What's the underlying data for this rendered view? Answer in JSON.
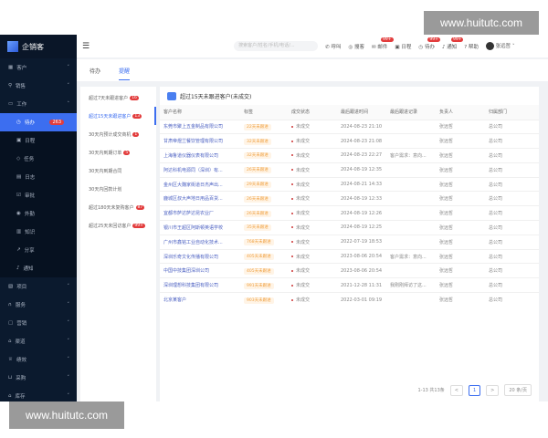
{
  "watermark": "www.huitutc.com",
  "app": {
    "name": "企销客"
  },
  "sidebar": {
    "items": [
      {
        "label": "客户",
        "icon": "customer-icon",
        "chevron": "˅"
      },
      {
        "label": "销售",
        "icon": "person-icon",
        "chevron": "˅"
      },
      {
        "label": "工作",
        "icon": "briefcase-icon",
        "chevron": "˄"
      },
      {
        "label": "待办",
        "icon": "clock-icon",
        "badge": "263",
        "sub": true,
        "active": true
      },
      {
        "label": "日程",
        "icon": "calendar-icon",
        "sub": true
      },
      {
        "label": "任务",
        "icon": "tag-icon",
        "sub": true
      },
      {
        "label": "日志",
        "icon": "log-icon",
        "sub": true
      },
      {
        "label": "审批",
        "icon": "approve-icon",
        "sub": true
      },
      {
        "label": "外勤",
        "icon": "location-icon",
        "sub": true
      },
      {
        "label": "知识",
        "icon": "book-icon",
        "sub": true
      },
      {
        "label": "分享",
        "icon": "share-icon",
        "sub": true
      },
      {
        "label": "通知",
        "icon": "bell-icon",
        "sub": true
      },
      {
        "label": "项目",
        "icon": "project-icon",
        "chevron": "˅"
      },
      {
        "label": "服务",
        "icon": "headset-icon",
        "chevron": "˅"
      },
      {
        "label": "营销",
        "icon": "marketing-icon",
        "chevron": "˅"
      },
      {
        "label": "渠道",
        "icon": "channel-icon",
        "chevron": "˅"
      },
      {
        "label": "绩效",
        "icon": "trophy-icon",
        "chevron": "˅"
      },
      {
        "label": "采购",
        "icon": "cart-icon",
        "chevron": "˅"
      },
      {
        "label": "库存",
        "icon": "warehouse-icon",
        "chevron": "˅"
      }
    ]
  },
  "header": {
    "search_placeholder": "搜索客户/姓名/手机/电话/...",
    "items": [
      {
        "label": "呼叫",
        "icon": "phone-icon"
      },
      {
        "label": "搜客",
        "icon": "search-icon"
      },
      {
        "label": "邮件",
        "icon": "mail-icon",
        "badge": "99+"
      },
      {
        "label": "日程",
        "icon": "calendar-icon"
      },
      {
        "label": "待办",
        "icon": "clock-icon",
        "badge": "99+"
      },
      {
        "label": "通知",
        "icon": "bell-icon",
        "badge": "99+"
      },
      {
        "label": "帮助",
        "icon": "help-icon"
      }
    ],
    "user": "张远哲"
  },
  "tabs": [
    {
      "label": "待办"
    },
    {
      "label": "提醒",
      "active": true
    }
  ],
  "reminders": [
    {
      "label": "超过7天未跟进客户",
      "badge": "16"
    },
    {
      "label": "超过15天未跟进客户",
      "badge": "13",
      "active": true
    },
    {
      "label": "30天内预计成交商机",
      "badge": "1"
    },
    {
      "label": "30天内到期订单",
      "badge": "5"
    },
    {
      "label": "30天内到期合同"
    },
    {
      "label": "30天内回款计划"
    },
    {
      "label": "超过180天未复购客户",
      "badge": "87"
    },
    {
      "label": "超过25天未回访客户",
      "badge": "99+"
    }
  ],
  "main": {
    "title": "超过15天未跟进客户(未成交)",
    "columns": [
      "客户名称",
      "标签",
      "成交状态",
      "最后跟进时间",
      "最后跟进记录",
      "负责人",
      "归属部门"
    ],
    "rows": [
      [
        "东莞市聚上五金制品有限公司",
        "22天未跟进",
        "未成交",
        "2024-08-23 21:10",
        "",
        "张远哲",
        "总公司"
      ],
      [
        "甘肃帝煜兰餐饮管理有限公司",
        "32天未跟进",
        "未成交",
        "2024-08-23 21:08",
        "",
        "张远哲",
        "总公司"
      ],
      [
        "上海鲁道仪器仪表有限公司",
        "32天未跟进",
        "未成交",
        "2024-08-23 22:27",
        "客户需求：意向...",
        "张远哲",
        "总公司"
      ],
      [
        "阿达科机电源同（深圳）有...",
        "26天未跟进",
        "未成交",
        "2024-08-19 12:35",
        "",
        "张远哲",
        "总公司"
      ],
      [
        "金州区大魏家街道日杰声出...",
        "29天未跟进",
        "未成交",
        "2024-08-21 14:33",
        "",
        "张远哲",
        "总公司"
      ],
      [
        "鹿城区叔大声地日用品百货...",
        "26天未跟进",
        "未成交",
        "2024-08-19 12:33",
        "",
        "张远哲",
        "总公司"
      ],
      [
        "宜都市萨达萨达昆农业厂",
        "26天未跟进",
        "未成交",
        "2024-08-19 12:26",
        "",
        "张远哲",
        "总公司"
      ],
      [
        "银川市王超区阿斯顿英语学校",
        "35天未跟进",
        "未成交",
        "2024-08-19 12:25",
        "",
        "张远哲",
        "总公司"
      ],
      [
        "广州市鑫铭工业自动化技术...",
        "768天未跟进",
        "未成交",
        "2022-07-19 18:53",
        "",
        "张远哲",
        "总公司"
      ],
      [
        "深圳乐奇文化传播有限公司",
        "405天未跟进",
        "未成交",
        "2023-08-06 20:54",
        "客户需求：意向...",
        "张远哲",
        "总公司"
      ],
      [
        "中国中技集团深圳公司",
        "405天未跟进",
        "未成交",
        "2023-08-06 20:54",
        "",
        "张远哲",
        "总公司"
      ],
      [
        "深圳理想科技集团有限公司",
        "991天未跟进",
        "未成交",
        "2021-12-28 11:31",
        "我刚刚拜访了这...",
        "张远哲",
        "总公司"
      ],
      [
        "北京某客户",
        "903天未跟进",
        "未成交",
        "2022-03-01 09:19",
        "",
        "张远哲",
        "总公司"
      ]
    ]
  },
  "pagination": {
    "summary": "1-13 共13条",
    "prev": "<",
    "page": "1",
    "next": ">",
    "page_size": "20 条/页"
  }
}
